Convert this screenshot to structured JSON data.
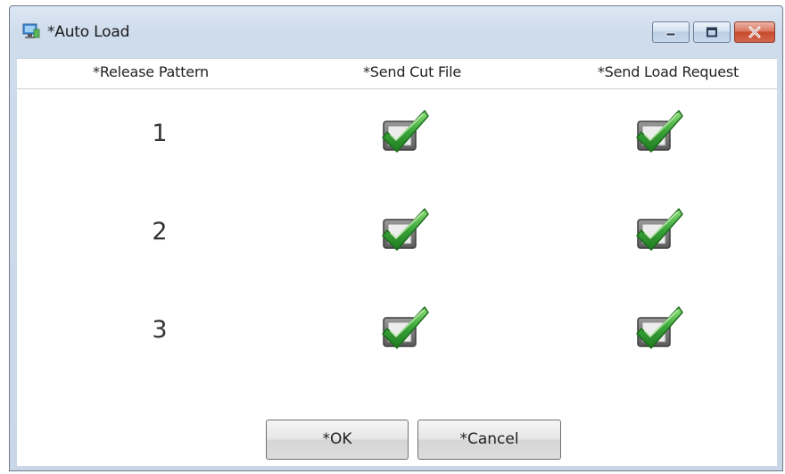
{
  "window": {
    "title": "*Auto Load"
  },
  "table": {
    "headers": [
      "*Release Pattern",
      "*Send Cut File",
      "*Send Load Request"
    ],
    "rows": [
      {
        "pattern": "1",
        "send_cut_file": true,
        "send_load_request": true
      },
      {
        "pattern": "2",
        "send_cut_file": true,
        "send_load_request": true
      },
      {
        "pattern": "3",
        "send_cut_file": true,
        "send_load_request": true
      }
    ]
  },
  "buttons": {
    "ok_label": "*OK",
    "cancel_label": "*Cancel"
  },
  "icons": {
    "app": "app-window-icon",
    "minimize": "minimize-icon",
    "maximize": "maximize-icon",
    "close": "close-icon",
    "checked": "green-checkmark-checkbox-icon"
  },
  "colors": {
    "check_green": "#3aa53a",
    "close_red": "#c74a2c",
    "titlebar": "#cfdcec"
  }
}
